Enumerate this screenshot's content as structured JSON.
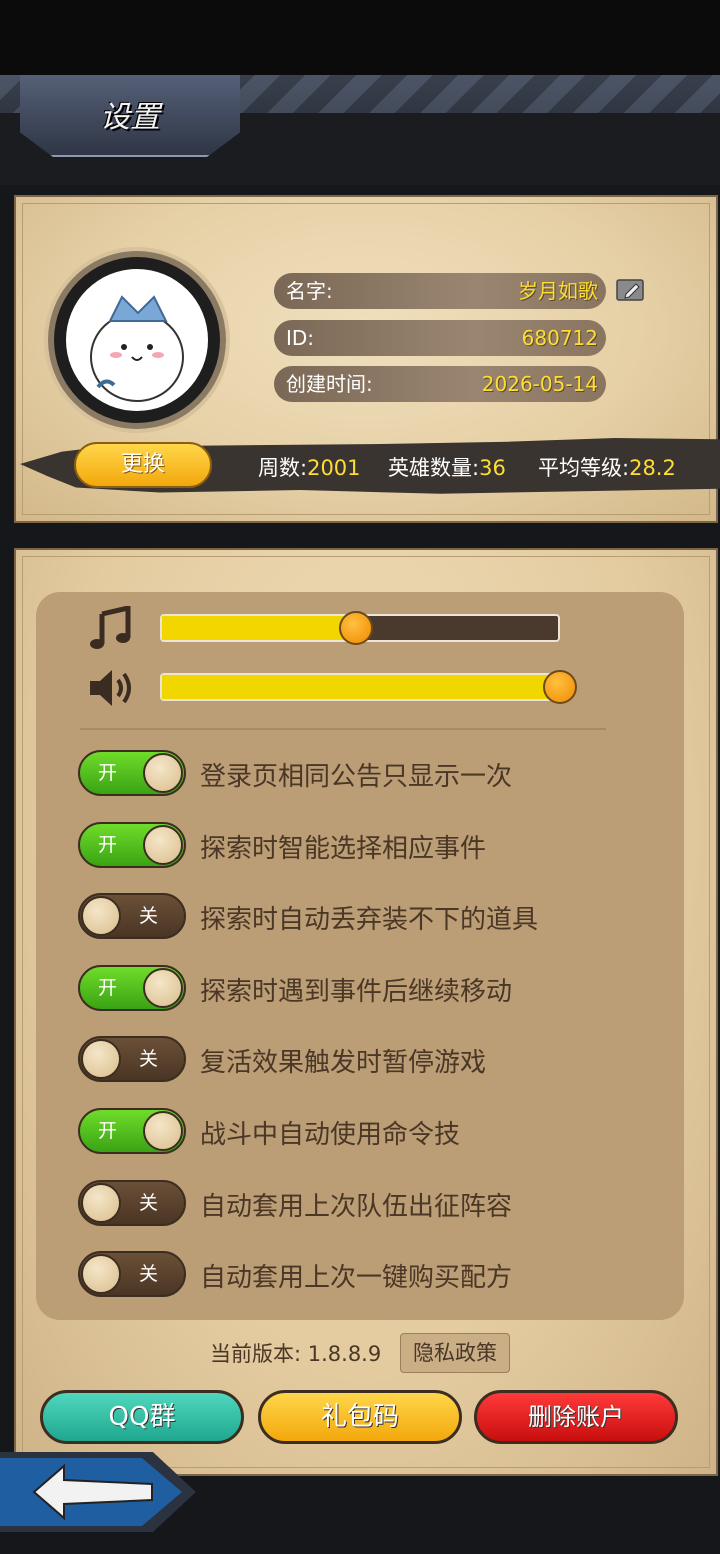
{
  "header": {
    "title": "设置"
  },
  "profile": {
    "name_label": "名字:",
    "name_value": "岁月如歌",
    "id_label": "ID:",
    "id_value": "680712",
    "created_label": "创建时间:",
    "created_value": "2026-05-14",
    "change_button": "更换"
  },
  "stats": {
    "weeks_label": "周数:",
    "weeks_value": "2001",
    "heroes_label": "英雄数量:",
    "heroes_value": "36",
    "avg_level_label": "平均等级:",
    "avg_level_value": "28.2"
  },
  "audio": {
    "music_level": 0.49,
    "sound_level": 1.0
  },
  "options": [
    {
      "label": "登录页相同公告只显示一次",
      "state": "开",
      "on": true
    },
    {
      "label": "探索时智能选择相应事件",
      "state": "开",
      "on": true
    },
    {
      "label": "探索时自动丢弃装不下的道具",
      "state": "关",
      "on": false
    },
    {
      "label": "探索时遇到事件后继续移动",
      "state": "开",
      "on": true
    },
    {
      "label": "复活效果触发时暂停游戏",
      "state": "关",
      "on": false
    },
    {
      "label": "战斗中自动使用命令技",
      "state": "开",
      "on": true
    },
    {
      "label": "自动套用上次队伍出征阵容",
      "state": "关",
      "on": false
    },
    {
      "label": "自动套用上次一键购买配方",
      "state": "关",
      "on": false
    }
  ],
  "footer": {
    "version_text": "当前版本: 1.8.8.9",
    "privacy_button": "隐私政策",
    "qq_button": "QQ群",
    "gift_button": "礼包码",
    "delete_button": "删除账户"
  },
  "colors": {
    "toggle_on": "#4cbf1c",
    "toggle_off": "#5a4230",
    "slider_fill": "#f1d600",
    "value_text": "#ffdd33"
  }
}
